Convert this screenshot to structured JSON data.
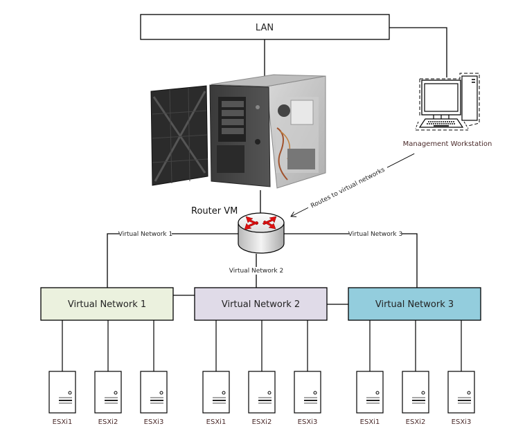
{
  "diagram": {
    "lan": {
      "label": "LAN",
      "fill": "#ffffff"
    },
    "server_image": {
      "name": "physical-server-tower"
    },
    "workstation": {
      "label": "Management Workstation",
      "icon": "desktop-computer-icon"
    },
    "router": {
      "label": "Router VM",
      "icon": "router-icon",
      "arrow_color": "#e01010"
    },
    "routes_annotation": "Routes to virtual networks",
    "link_labels": {
      "vn1": "Virtual Network 1",
      "vn2": "Virtual Network 2",
      "vn3": "Virtual Network 3"
    },
    "networks": [
      {
        "label": "Virtual Network 1",
        "fill": "#ebf1de",
        "hosts": [
          {
            "label": "ESXi1"
          },
          {
            "label": "ESXi2"
          },
          {
            "label": "ESXi3"
          }
        ]
      },
      {
        "label": "Virtual Network 2",
        "fill": "#e0dbe8",
        "hosts": [
          {
            "label": "ESXi1"
          },
          {
            "label": "ESXi2"
          },
          {
            "label": "ESXi3"
          }
        ]
      },
      {
        "label": "Virtual Network 3",
        "fill": "#93cddd",
        "hosts": [
          {
            "label": "ESXi1"
          },
          {
            "label": "ESXi2"
          },
          {
            "label": "ESXi3"
          }
        ]
      }
    ]
  }
}
